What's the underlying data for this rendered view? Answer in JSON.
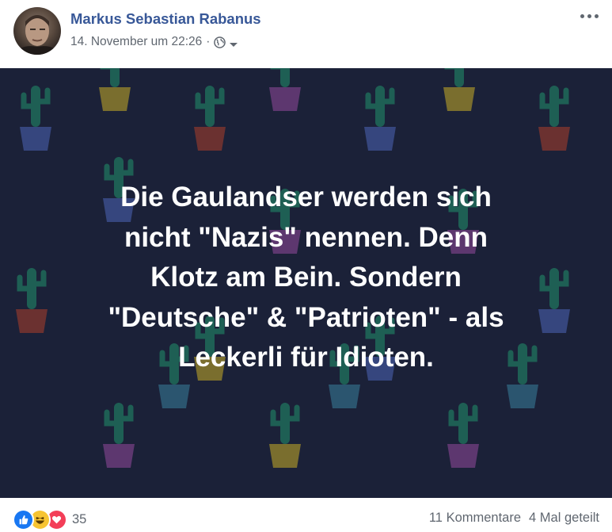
{
  "post": {
    "author": "Markus Sebastian Rabanus",
    "timestamp": "14. November um 22:26",
    "separator": "·",
    "audience_icon": "globe-icon",
    "menu_icon": "more-options-icon",
    "text_lines": [
      "Die Gaulandser werden sich",
      "nicht \"Nazis\" nennen. Denn",
      "Klotz am Bein. Sondern",
      "\"Deutsche\" & \"Patrioten\" - als",
      "Leckerli für Idioten."
    ]
  },
  "footer": {
    "reaction_icons": [
      "like-icon",
      "haha-icon",
      "love-icon"
    ],
    "reaction_count": "35",
    "comments": "11 Kommentare",
    "shares": "4 Mal geteilt"
  },
  "colors": {
    "author_link": "#385898",
    "meta": "#606770",
    "image_bg": "#1b2138",
    "like": "#1877f2",
    "haha": "#f7c432",
    "love": "#f33e58"
  }
}
